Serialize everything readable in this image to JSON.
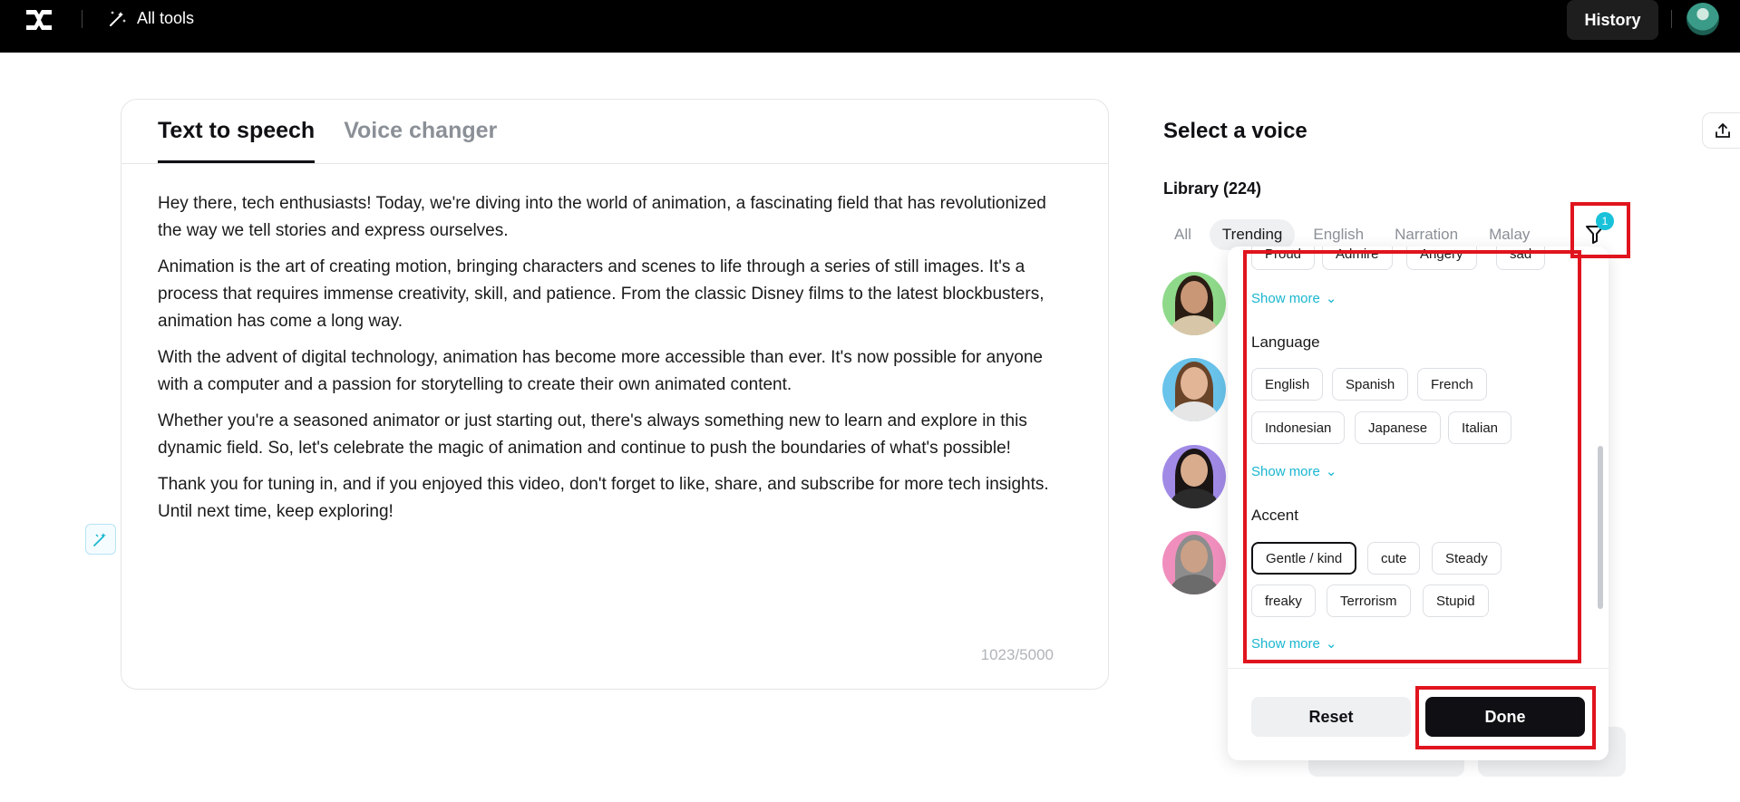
{
  "topbar": {
    "all_tools_label": "All tools",
    "history_label": "History"
  },
  "editor": {
    "tabs": [
      {
        "label": "Text to speech",
        "active": true
      },
      {
        "label": "Voice changer",
        "active": false
      }
    ],
    "paragraphs": [
      "Hey there, tech enthusiasts! Today, we're diving into the world of animation, a fascinating field that has revolutionized the way we tell stories and express ourselves.",
      "Animation is the art of creating motion, bringing characters and scenes to life through a series of still images. It's a process that requires immense creativity, skill, and patience. From the classic Disney films to the latest blockbusters, animation has come a long way.",
      "With the advent of digital technology, animation has become more accessible than ever. It's now possible for anyone with a computer and a passion for storytelling to create their own animated content.",
      "Whether you're a seasoned animator or just starting out, there's always something new to learn and explore in this dynamic field. So, let's celebrate the magic of animation and continue to push the boundaries of what's possible!",
      "Thank you for tuning in, and if you enjoyed this video, don't forget to like, share, and subscribe for more tech insights. Until next time, keep exploring!"
    ],
    "char_counter": "1023/5000"
  },
  "voice_panel": {
    "title": "Select a voice",
    "library_label": "Library (224)",
    "categories": [
      {
        "label": "All",
        "active": false
      },
      {
        "label": "Trending",
        "active": true
      },
      {
        "label": "English",
        "active": false
      },
      {
        "label": "Narration",
        "active": false
      },
      {
        "label": "Malay",
        "active": false
      }
    ],
    "filter_badge_count": "1"
  },
  "filter_popup": {
    "emotion_tags": [
      "Proud",
      "Admire",
      "Angery",
      "sad"
    ],
    "show_more_label": "Show more",
    "language": {
      "title": "Language",
      "tags": [
        "English",
        "Spanish",
        "French",
        "Indonesian",
        "Japanese",
        "Italian"
      ]
    },
    "accent": {
      "title": "Accent",
      "tags": [
        "Gentle / kind",
        "cute",
        "Steady",
        "freaky",
        "Terrorism",
        "Stupid"
      ],
      "selected": "Gentle / kind"
    },
    "reset_label": "Reset",
    "done_label": "Done"
  },
  "colors": {
    "accent_cyan": "#19b6d0",
    "highlight_red": "#e0141e",
    "primary_dark": "#101014"
  }
}
